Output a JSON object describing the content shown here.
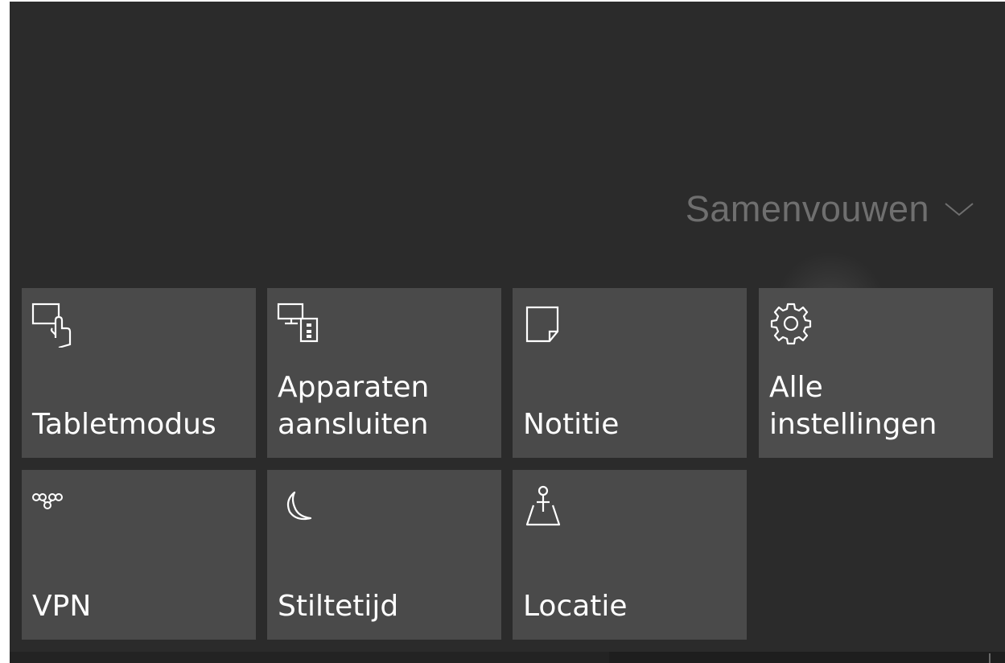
{
  "action_center": {
    "collapse_label": "Samenvouwen",
    "collapse_icon": "chevron-down-icon",
    "tiles": [
      {
        "label": "Tabletmodus",
        "icon": "tablet-mode-icon"
      },
      {
        "label": "Apparaten\naansluiten",
        "icon": "connect-devices-icon"
      },
      {
        "label": "Notitie",
        "icon": "note-icon"
      },
      {
        "label": "Alle\ninstellingen",
        "icon": "gear-icon"
      },
      {
        "label": "VPN",
        "icon": "vpn-icon"
      },
      {
        "label": "Stiltetijd",
        "icon": "moon-icon"
      },
      {
        "label": "Locatie",
        "icon": "location-icon"
      }
    ]
  },
  "colors": {
    "background": "#2b2b2b",
    "tile": "#4a4a4a",
    "collapse_text": "#6f6f6f",
    "tile_text": "#ffffff"
  }
}
